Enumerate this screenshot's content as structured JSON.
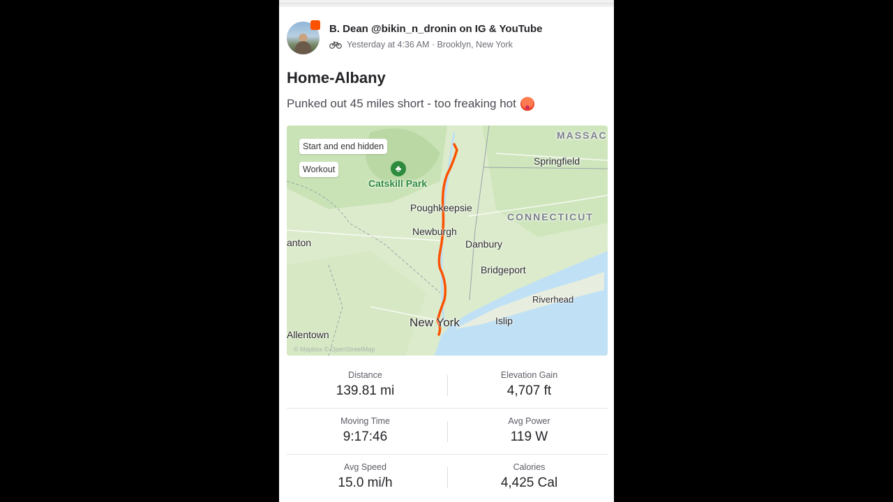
{
  "post": {
    "author": "B. Dean @bikin_n_dronin on IG & YouTube",
    "meta": "Yesterday at 4:36 AM · Brooklyn, New York",
    "title": "Home-Albany",
    "description": "Punked out 45 miles short - too freaking hot",
    "activity_icon": "bike-icon",
    "emoji_icon": "hot-face-emoji-icon"
  },
  "map": {
    "chips": {
      "start_end": "Start and end hidden",
      "workout": "Workout"
    },
    "labels": {
      "massac": "MASSAC",
      "springfield": "Springfield",
      "catskill": "Catskill Park",
      "poughkeepsie": "Poughkeepsie",
      "connecticut": "CONNECTICUT",
      "newburgh": "Newburgh",
      "danbury": "Danbury",
      "scranton": "anton",
      "bridgeport": "Bridgeport",
      "riverhead": "Riverhead",
      "new_york": "New York",
      "islip": "Islip",
      "allentown": "Allentown"
    },
    "attribution": "© Mapbox © OpenStreetMap",
    "route_color": "#fc5200",
    "water_color": "#bfe0f5",
    "land_color": "#dfeccf"
  },
  "stats": [
    [
      {
        "label": "Distance",
        "value": "139.81 mi"
      },
      {
        "label": "Elevation Gain",
        "value": "4,707 ft"
      }
    ],
    [
      {
        "label": "Moving Time",
        "value": "9:17:46"
      },
      {
        "label": "Avg Power",
        "value": "119 W"
      }
    ],
    [
      {
        "label": "Avg Speed",
        "value": "15.0 mi/h"
      },
      {
        "label": "Calories",
        "value": "4,425 Cal"
      }
    ]
  ]
}
